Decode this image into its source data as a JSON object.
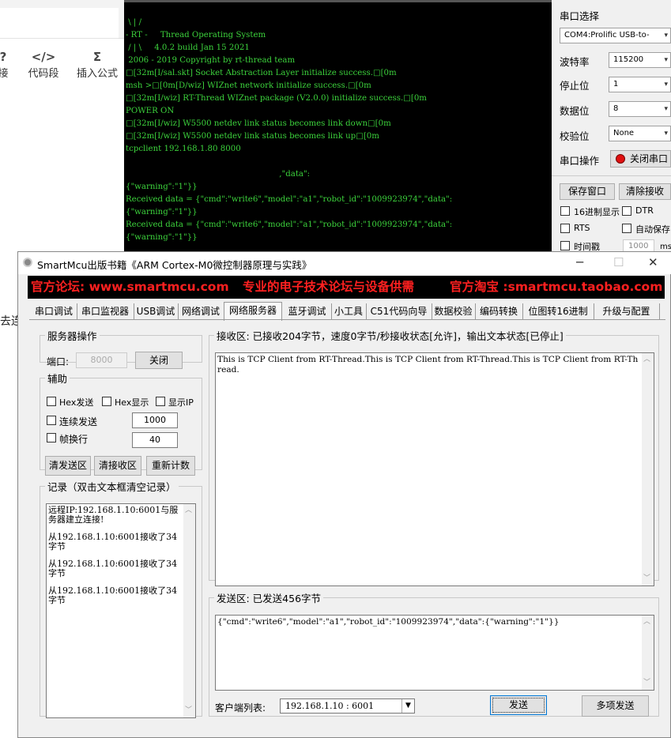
{
  "bg_editor": {
    "tools": [
      {
        "icon": "?",
        "label": "接"
      },
      {
        "icon": "</>",
        "label": "代码段"
      },
      {
        "icon": "Σ",
        "label": "插入公式"
      }
    ],
    "side_text": "去连"
  },
  "terminal": {
    "lines": [
      " \\ | /",
      "- RT -     Thread Operating System",
      " / | \\     4.0.2 build Jan 15 2021",
      " 2006 - 2019 Copyright by rt-thread team",
      "□[32m[I/sal.skt] Socket Abstraction Layer initialize success.□[0m",
      "msh >□[0m[D/wiz] WIZnet network initialize success.□[0m",
      "□[32m[I/wiz] RT-Thread WIZnet package (V2.0.0) initialize success.□[0m",
      "POWER ON",
      "□[32m[I/wiz] W5500 netdev link status becomes link down□[0m",
      "□[32m[I/wiz] W5500 netdev link status becomes link up□[0m",
      "tcpclient 192.168.1.80 8000",
      "",
      "                                                            ,\"data\":",
      "{\"warning\":\"1\"}}",
      "Received data = {\"cmd\":\"write6\",\"model\":\"a1\",\"robot_id\":\"1009923974\",\"data\":",
      "{\"warning\":\"1\"}}",
      "Received data = {\"cmd\":\"write6\",\"model\":\"a1\",\"robot_id\":\"1009923974\",\"data\":",
      "{\"warning\":\"1\"}}"
    ]
  },
  "serial_panel": {
    "port_label": "串口选择",
    "port_value": "COM4:Prolific USB-to-",
    "baud_label": "波特率",
    "baud_value": "115200",
    "stop_label": "停止位",
    "stop_value": "1",
    "data_label": "数据位",
    "data_value": "8",
    "parity_label": "校验位",
    "parity_value": "None",
    "op_label": "串口操作",
    "close_port": "关闭串口",
    "save_window": "保存窗口",
    "clear_recv": "清除接收",
    "hex_display": "16进制显示",
    "dtr": "DTR",
    "rts": "RTS",
    "auto_save": "自动保存",
    "timestamp": "时间戳",
    "timestamp_value": "1000",
    "ms": "ms"
  },
  "window": {
    "title": "SmartMcu出版书籍《ARM Cortex-M0微控制器原理与实践》",
    "banner": {
      "forum": "官方论坛: www.smartmcu.com",
      "slogan": "专业的电子技术论坛与设备供需",
      "shop": "官方淘宝 :smartmcu.taobao.com"
    },
    "tabs": [
      "串口调试",
      "串口监视器",
      "USB调试",
      "网络调试",
      "网络服务器",
      "蓝牙调试",
      "小工具",
      "C51代码向导",
      "数据校验",
      "编码转换",
      "位图转16进制",
      "升级与配置"
    ],
    "active_tab": 4,
    "server_ops": {
      "legend": "服务器操作",
      "port_label": "端口:",
      "port_value": "8000",
      "close_button": "关闭"
    },
    "aux": {
      "legend": "辅助",
      "hex_send": "Hex发送",
      "hex_display": "Hex显示",
      "show_ip": "显示IP",
      "continuous_send": "连续发送",
      "continuous_value": "1000",
      "frame_newline": "帧换行",
      "frame_value": "40",
      "clear_send": "清发送区",
      "clear_recv": "清接收区",
      "reset_count": "重新计数"
    },
    "log": {
      "legend": "记录（双击文本框清空记录）",
      "entries": [
        "远程IP:192.168.1.10:6001与服务器建立连接!",
        "从192.168.1.10:6001接收了34字节",
        "从192.168.1.10:6001接收了34字节",
        "从192.168.1.10:6001接收了34字节"
      ]
    },
    "recv": {
      "legend": "接收区: 已接收204字节，速度0字节/秒接收状态[允许]，输出文本状态[已停止]",
      "text": "This is TCP Client from RT-Thread.This is TCP Client from RT-Thread.This is TCP Client from RT-Thread."
    },
    "send": {
      "legend": "发送区: 已发送456字节",
      "text": "{\"cmd\":\"write6\",\"model\":\"a1\",\"robot_id\":\"1009923974\",\"data\":{\"warning\":\"1\"}}",
      "client_label": "客户端列表:",
      "client_value": "192.168.1.10 : 6001",
      "send_button": "发送",
      "multi_send_button": "多项发送"
    }
  }
}
